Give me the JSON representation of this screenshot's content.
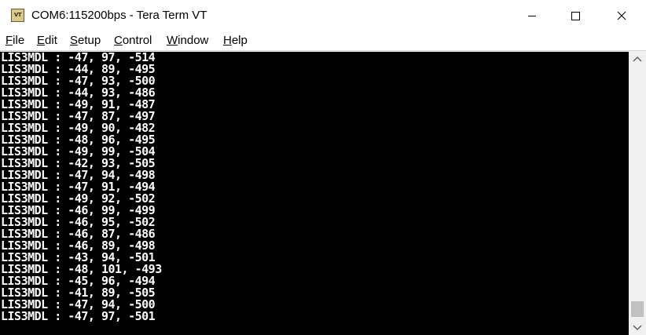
{
  "window": {
    "title": "COM6:115200bps - Tera Term VT",
    "icon_label": "VT"
  },
  "menu": {
    "items": [
      {
        "label": "File",
        "accel": "F",
        "rest": "ile"
      },
      {
        "label": "Edit",
        "accel": "E",
        "rest": "dit"
      },
      {
        "label": "Setup",
        "accel": "S",
        "rest": "etup"
      },
      {
        "label": "Control",
        "accel": "C",
        "rest": "ontrol"
      },
      {
        "label": "Window",
        "accel": "W",
        "rest": "indow"
      },
      {
        "label": "Help",
        "accel": "H",
        "rest": "elp"
      }
    ]
  },
  "terminal": {
    "background": "#000000",
    "foreground": "#ffffff",
    "lines": [
      "LIS3MDL : -47, 97, -514",
      "LIS3MDL : -44, 89, -495",
      "LIS3MDL : -47, 93, -500",
      "LIS3MDL : -44, 93, -486",
      "LIS3MDL : -49, 91, -487",
      "LIS3MDL : -47, 87, -497",
      "LIS3MDL : -49, 90, -482",
      "LIS3MDL : -48, 96, -495",
      "LIS3MDL : -49, 99, -504",
      "LIS3MDL : -42, 93, -505",
      "LIS3MDL : -47, 94, -498",
      "LIS3MDL : -47, 91, -494",
      "LIS3MDL : -49, 92, -502",
      "LIS3MDL : -46, 99, -499",
      "LIS3MDL : -46, 95, -502",
      "LIS3MDL : -46, 87, -486",
      "LIS3MDL : -46, 89, -498",
      "LIS3MDL : -43, 94, -501",
      "LIS3MDL : -48, 101, -493",
      "LIS3MDL : -45, 96, -494",
      "LIS3MDL : -41, 89, -505",
      "LIS3MDL : -47, 94, -500",
      "LIS3MDL : -47, 97, -501"
    ]
  },
  "scrollbar": {
    "position_fraction": 1.0
  },
  "icons": {
    "app": "tera-term-icon",
    "minimize": "minimize-icon",
    "maximize": "maximize-icon",
    "close": "close-icon",
    "scroll_up": "chevron-up-icon",
    "scroll_down": "chevron-down-icon"
  }
}
